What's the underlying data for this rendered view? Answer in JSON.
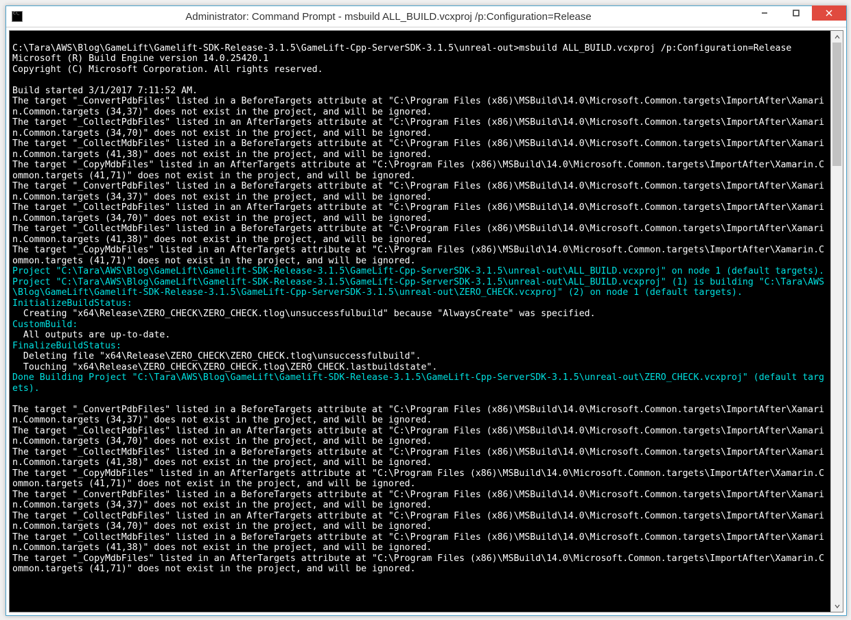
{
  "window": {
    "title": "Administrator: Command Prompt - msbuild  ALL_BUILD.vcxproj /p:Configuration=Release"
  },
  "console": {
    "lines": [
      {
        "t": "",
        "c": "w"
      },
      {
        "t": "C:\\Tara\\AWS\\Blog\\GameLift\\Gamelift-SDK-Release-3.1.5\\GameLift-Cpp-ServerSDK-3.1.5\\unreal-out>msbuild ALL_BUILD.vcxproj /p:Configuration=Release",
        "c": "w"
      },
      {
        "t": "Microsoft (R) Build Engine version 14.0.25420.1",
        "c": "w"
      },
      {
        "t": "Copyright (C) Microsoft Corporation. All rights reserved.",
        "c": "w"
      },
      {
        "t": "",
        "c": "w"
      },
      {
        "t": "Build started 3/1/2017 7:11:52 AM.",
        "c": "w"
      },
      {
        "t": "The target \"_ConvertPdbFiles\" listed in a BeforeTargets attribute at \"C:\\Program Files (x86)\\MSBuild\\14.0\\Microsoft.Common.targets\\ImportAfter\\Xamarin.Common.targets (34,37)\" does not exist in the project, and will be ignored.",
        "c": "w"
      },
      {
        "t": "The target \"_CollectPdbFiles\" listed in an AfterTargets attribute at \"C:\\Program Files (x86)\\MSBuild\\14.0\\Microsoft.Common.targets\\ImportAfter\\Xamarin.Common.targets (34,70)\" does not exist in the project, and will be ignored.",
        "c": "w"
      },
      {
        "t": "The target \"_CollectMdbFiles\" listed in a BeforeTargets attribute at \"C:\\Program Files (x86)\\MSBuild\\14.0\\Microsoft.Common.targets\\ImportAfter\\Xamarin.Common.targets (41,38)\" does not exist in the project, and will be ignored.",
        "c": "w"
      },
      {
        "t": "The target \"_CopyMdbFiles\" listed in an AfterTargets attribute at \"C:\\Program Files (x86)\\MSBuild\\14.0\\Microsoft.Common.targets\\ImportAfter\\Xamarin.Common.targets (41,71)\" does not exist in the project, and will be ignored.",
        "c": "w"
      },
      {
        "t": "The target \"_ConvertPdbFiles\" listed in a BeforeTargets attribute at \"C:\\Program Files (x86)\\MSBuild\\14.0\\Microsoft.Common.targets\\ImportAfter\\Xamarin.Common.targets (34,37)\" does not exist in the project, and will be ignored.",
        "c": "w"
      },
      {
        "t": "The target \"_CollectPdbFiles\" listed in an AfterTargets attribute at \"C:\\Program Files (x86)\\MSBuild\\14.0\\Microsoft.Common.targets\\ImportAfter\\Xamarin.Common.targets (34,70)\" does not exist in the project, and will be ignored.",
        "c": "w"
      },
      {
        "t": "The target \"_CollectMdbFiles\" listed in a BeforeTargets attribute at \"C:\\Program Files (x86)\\MSBuild\\14.0\\Microsoft.Common.targets\\ImportAfter\\Xamarin.Common.targets (41,38)\" does not exist in the project, and will be ignored.",
        "c": "w"
      },
      {
        "t": "The target \"_CopyMdbFiles\" listed in an AfterTargets attribute at \"C:\\Program Files (x86)\\MSBuild\\14.0\\Microsoft.Common.targets\\ImportAfter\\Xamarin.Common.targets (41,71)\" does not exist in the project, and will be ignored.",
        "c": "w"
      },
      {
        "t": "Project \"C:\\Tara\\AWS\\Blog\\GameLift\\Gamelift-SDK-Release-3.1.5\\GameLift-Cpp-ServerSDK-3.1.5\\unreal-out\\ALL_BUILD.vcxproj\" on node 1 (default targets).",
        "c": "c"
      },
      {
        "t": "Project \"C:\\Tara\\AWS\\Blog\\GameLift\\Gamelift-SDK-Release-3.1.5\\GameLift-Cpp-ServerSDK-3.1.5\\unreal-out\\ALL_BUILD.vcxproj\" (1) is building \"C:\\Tara\\AWS\\Blog\\GameLift\\Gamelift-SDK-Release-3.1.5\\GameLift-Cpp-ServerSDK-3.1.5\\unreal-out\\ZERO_CHECK.vcxproj\" (2) on node 1 (default targets).",
        "c": "c"
      },
      {
        "t": "InitializeBuildStatus:",
        "c": "c"
      },
      {
        "t": "  Creating \"x64\\Release\\ZERO_CHECK\\ZERO_CHECK.tlog\\unsuccessfulbuild\" because \"AlwaysCreate\" was specified.",
        "c": "w"
      },
      {
        "t": "CustomBuild:",
        "c": "c"
      },
      {
        "t": "  All outputs are up-to-date.",
        "c": "w"
      },
      {
        "t": "FinalizeBuildStatus:",
        "c": "c"
      },
      {
        "t": "  Deleting file \"x64\\Release\\ZERO_CHECK\\ZERO_CHECK.tlog\\unsuccessfulbuild\".",
        "c": "w"
      },
      {
        "t": "  Touching \"x64\\Release\\ZERO_CHECK\\ZERO_CHECK.tlog\\ZERO_CHECK.lastbuildstate\".",
        "c": "w"
      },
      {
        "t": "Done Building Project \"C:\\Tara\\AWS\\Blog\\GameLift\\Gamelift-SDK-Release-3.1.5\\GameLift-Cpp-ServerSDK-3.1.5\\unreal-out\\ZERO_CHECK.vcxproj\" (default targets).",
        "c": "c"
      },
      {
        "t": "",
        "c": "w"
      },
      {
        "t": "The target \"_ConvertPdbFiles\" listed in a BeforeTargets attribute at \"C:\\Program Files (x86)\\MSBuild\\14.0\\Microsoft.Common.targets\\ImportAfter\\Xamarin.Common.targets (34,37)\" does not exist in the project, and will be ignored.",
        "c": "w"
      },
      {
        "t": "The target \"_CollectPdbFiles\" listed in an AfterTargets attribute at \"C:\\Program Files (x86)\\MSBuild\\14.0\\Microsoft.Common.targets\\ImportAfter\\Xamarin.Common.targets (34,70)\" does not exist in the project, and will be ignored.",
        "c": "w"
      },
      {
        "t": "The target \"_CollectMdbFiles\" listed in a BeforeTargets attribute at \"C:\\Program Files (x86)\\MSBuild\\14.0\\Microsoft.Common.targets\\ImportAfter\\Xamarin.Common.targets (41,38)\" does not exist in the project, and will be ignored.",
        "c": "w"
      },
      {
        "t": "The target \"_CopyMdbFiles\" listed in an AfterTargets attribute at \"C:\\Program Files (x86)\\MSBuild\\14.0\\Microsoft.Common.targets\\ImportAfter\\Xamarin.Common.targets (41,71)\" does not exist in the project, and will be ignored.",
        "c": "w"
      },
      {
        "t": "The target \"_ConvertPdbFiles\" listed in a BeforeTargets attribute at \"C:\\Program Files (x86)\\MSBuild\\14.0\\Microsoft.Common.targets\\ImportAfter\\Xamarin.Common.targets (34,37)\" does not exist in the project, and will be ignored.",
        "c": "w"
      },
      {
        "t": "The target \"_CollectPdbFiles\" listed in an AfterTargets attribute at \"C:\\Program Files (x86)\\MSBuild\\14.0\\Microsoft.Common.targets\\ImportAfter\\Xamarin.Common.targets (34,70)\" does not exist in the project, and will be ignored.",
        "c": "w"
      },
      {
        "t": "The target \"_CollectMdbFiles\" listed in a BeforeTargets attribute at \"C:\\Program Files (x86)\\MSBuild\\14.0\\Microsoft.Common.targets\\ImportAfter\\Xamarin.Common.targets (41,38)\" does not exist in the project, and will be ignored.",
        "c": "w"
      },
      {
        "t": "The target \"_CopyMdbFiles\" listed in an AfterTargets attribute at \"C:\\Program Files (x86)\\MSBuild\\14.0\\Microsoft.Common.targets\\ImportAfter\\Xamarin.Common.targets (41,71)\" does not exist in the project, and will be ignored.",
        "c": "w"
      }
    ]
  }
}
